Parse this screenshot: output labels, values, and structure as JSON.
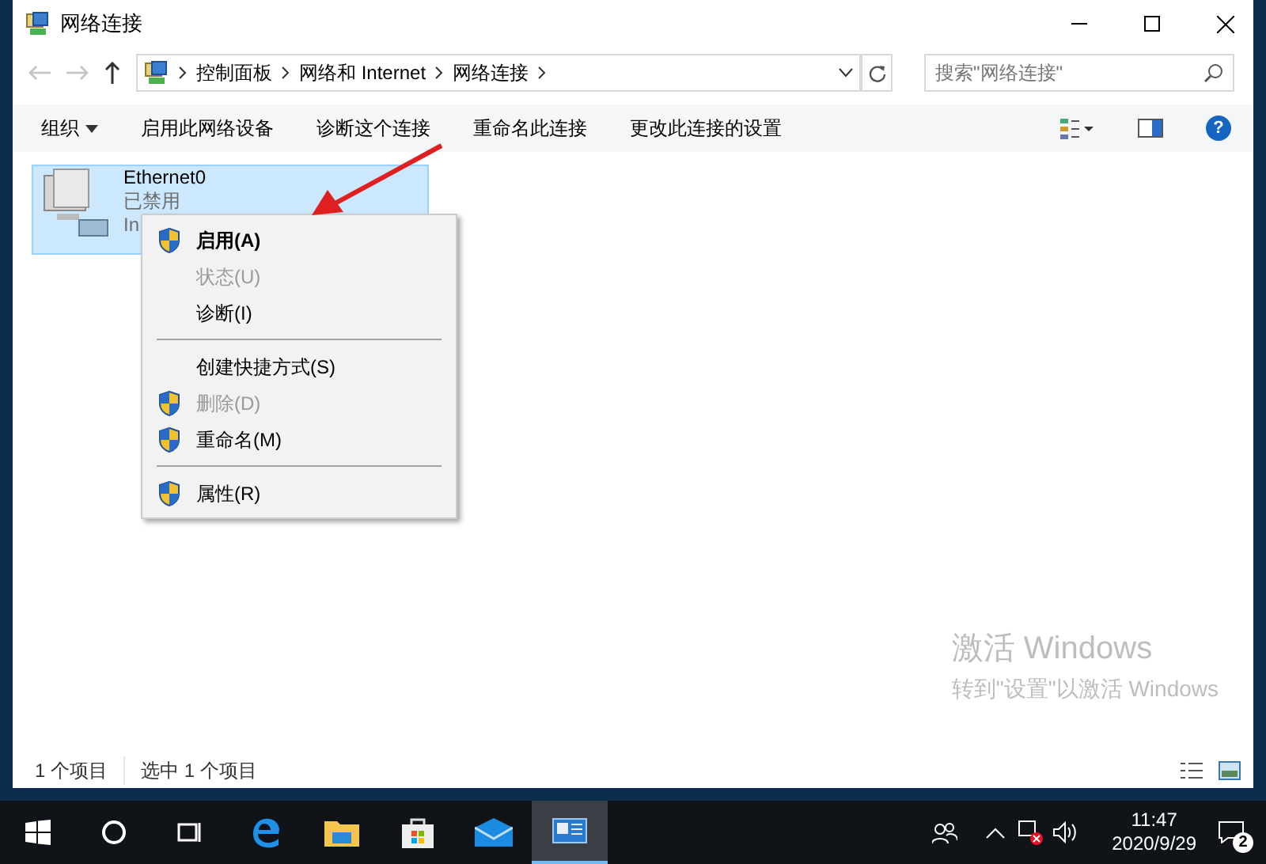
{
  "window": {
    "title": "网络连接"
  },
  "nav": {
    "breadcrumb": [
      "控制面板",
      "网络和 Internet",
      "网络连接"
    ],
    "search": {
      "placeholder": "搜索\"网络连接\""
    }
  },
  "toolbar": {
    "help": "?",
    "items": [
      {
        "label": "组织",
        "dropdown": true
      },
      {
        "label": "启用此网络设备",
        "dropdown": false
      },
      {
        "label": "诊断这个连接",
        "dropdown": false
      },
      {
        "label": "重命名此连接",
        "dropdown": false
      },
      {
        "label": "更改此连接的设置",
        "dropdown": false
      }
    ]
  },
  "adapter": {
    "name": "Ethernet0",
    "status": "已禁用",
    "description": "In",
    "selected": true
  },
  "context_menu": {
    "items": [
      {
        "kind": "item",
        "label": "启用(A)",
        "shield": true,
        "default": true,
        "disabled": false
      },
      {
        "kind": "item",
        "label": "状态(U)",
        "shield": false,
        "default": false,
        "disabled": true
      },
      {
        "kind": "item",
        "label": "诊断(I)",
        "shield": false,
        "default": false,
        "disabled": false
      },
      {
        "kind": "separator"
      },
      {
        "kind": "item",
        "label": "创建快捷方式(S)",
        "shield": false,
        "default": false,
        "disabled": false
      },
      {
        "kind": "item",
        "label": "删除(D)",
        "shield": true,
        "default": false,
        "disabled": true
      },
      {
        "kind": "item",
        "label": "重命名(M)",
        "shield": true,
        "default": false,
        "disabled": false
      },
      {
        "kind": "separator"
      },
      {
        "kind": "item",
        "label": "属性(R)",
        "shield": true,
        "default": false,
        "disabled": false
      }
    ]
  },
  "activation": {
    "title": "激活 Windows",
    "subtitle": "转到\"设置\"以激活 Windows"
  },
  "status_bar": {
    "items": [
      "1 个项目",
      "选中 1 个项目"
    ]
  },
  "taskbar": {
    "time": "11:47",
    "date": "2020/9/29",
    "notifications": "2"
  }
}
